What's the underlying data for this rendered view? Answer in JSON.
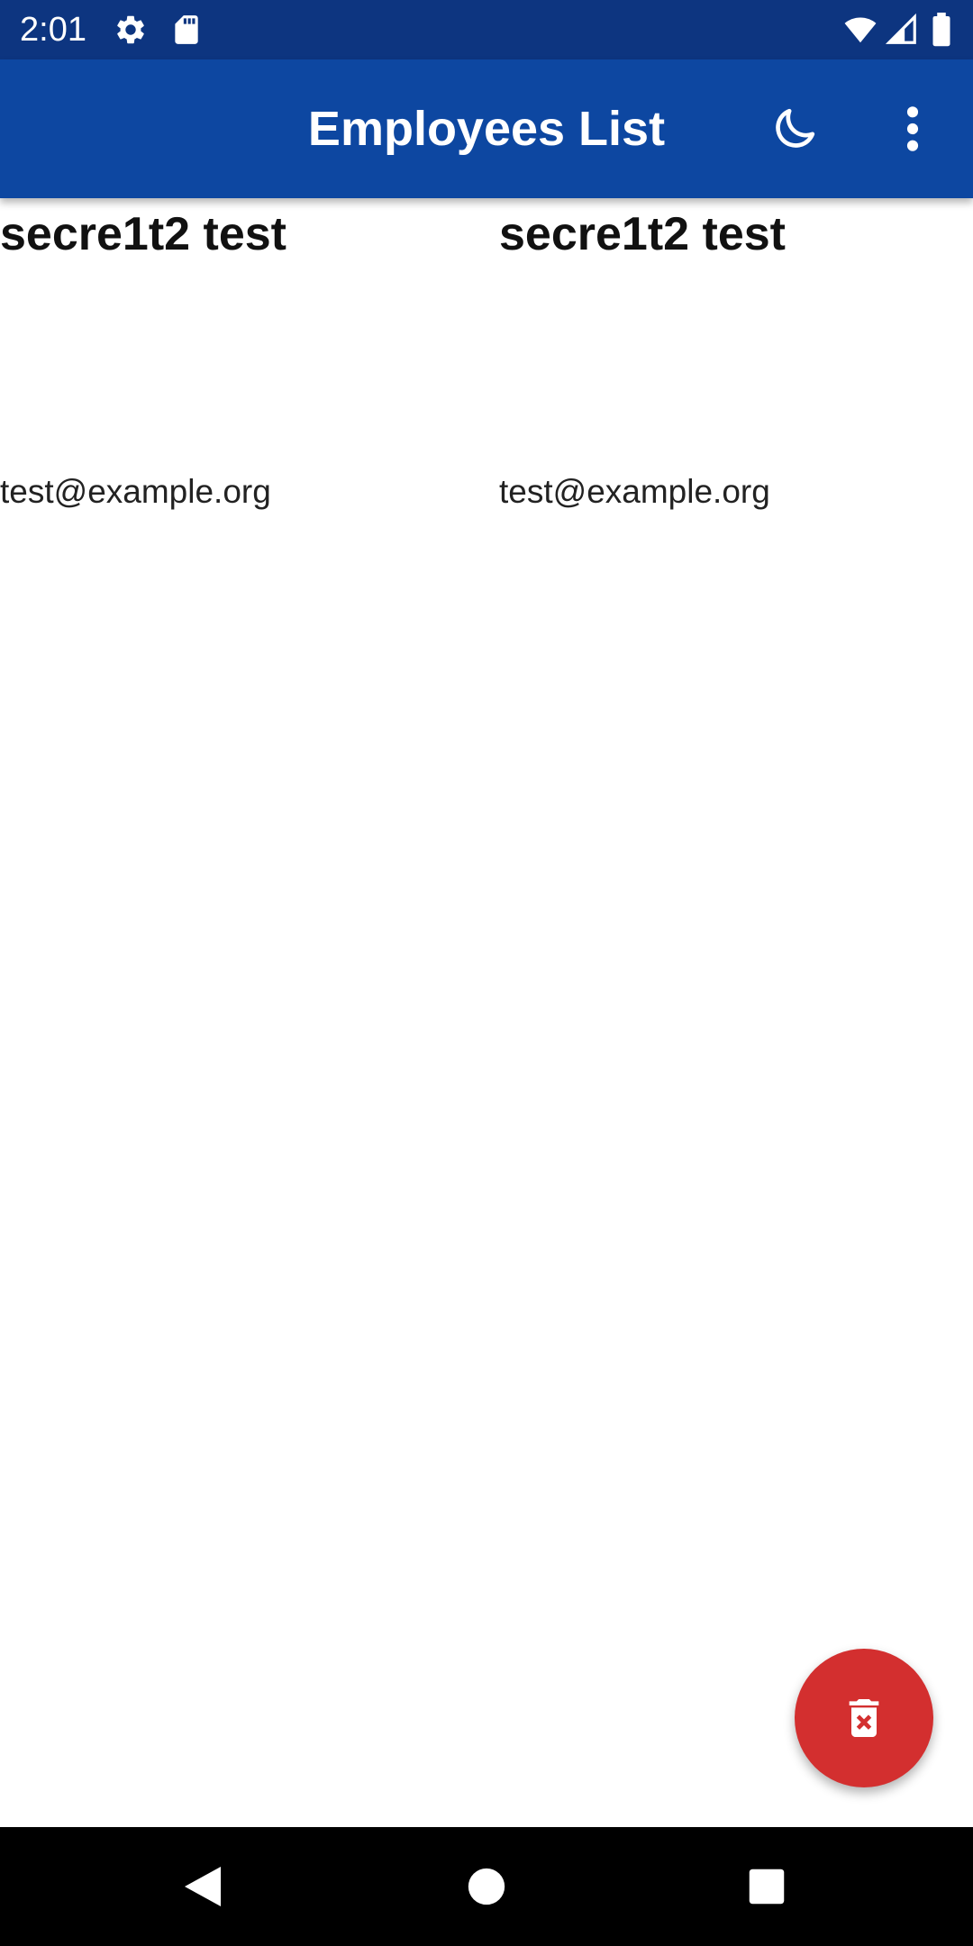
{
  "status_bar": {
    "time": "2:01",
    "icons_left": [
      "gear-icon",
      "sd-card-icon"
    ],
    "icons_right": [
      "wifi-icon",
      "signal-icon",
      "battery-icon"
    ],
    "background": "#0d3580"
  },
  "app_bar": {
    "title": "Employees List",
    "actions": [
      "moon-icon",
      "more-vert-icon"
    ],
    "background": "#0d47a1"
  },
  "employees": [
    {
      "name": "secre1t2 test",
      "email": "test@example.org"
    },
    {
      "name": "secre1t2 test",
      "email": "test@example.org"
    }
  ],
  "fab": {
    "icon": "delete-forever-icon",
    "color": "#d32f2f"
  },
  "navigation_bar": {
    "buttons": [
      "back-icon",
      "home-icon",
      "recents-icon"
    ]
  }
}
